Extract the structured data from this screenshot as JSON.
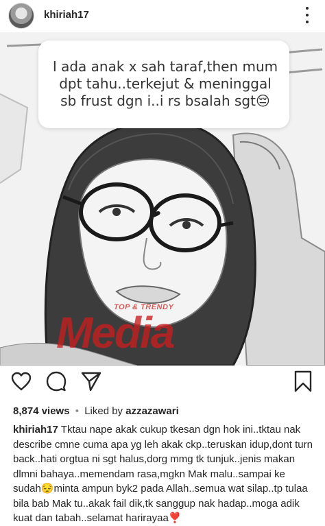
{
  "header": {
    "username": "khiriah17",
    "more_icon": "more-dots-icon"
  },
  "post": {
    "question_text": "I ada anak x sah taraf,then mum dpt tahu..terkejut & meninggal sb frust dgn i..i rs bsalah sgt😔",
    "watermark_small": "TOP & TRENDY",
    "watermark_big": "Media"
  },
  "actions": {
    "like_icon": "heart-icon",
    "comment_icon": "comment-icon",
    "share_icon": "send-icon",
    "save_icon": "bookmark-icon"
  },
  "stats": {
    "views": "8,874 views",
    "separator": "•",
    "liked_by_prefix": "Liked by",
    "liked_by_user": "azzazawari"
  },
  "caption": {
    "username": "khiriah17",
    "text": "Tktau nape akak cukup tkesan dgn hok ini..tktau nak describe cmne cuma apa yg leh akak ckp..teruskan idup,dont turn back..hati orgtua ni sgt halus,dorg mmg tk tunjuk..jenis makan dlmni bahaya..memendam rasa,mgkn Mak malu..sampai ke sudah😔minta ampun byk2 pada Allah..semua wat silap..tp tulaa bila bab Mak tu..akak fail dik,tk sanggup nak hadap..moga adik kuat dan tabah..selamat harirayaa",
    "end_emoji": "❣️"
  },
  "colors": {
    "text": "#262626",
    "muted": "#8e8e8e",
    "watermark": "#c81e1e"
  }
}
